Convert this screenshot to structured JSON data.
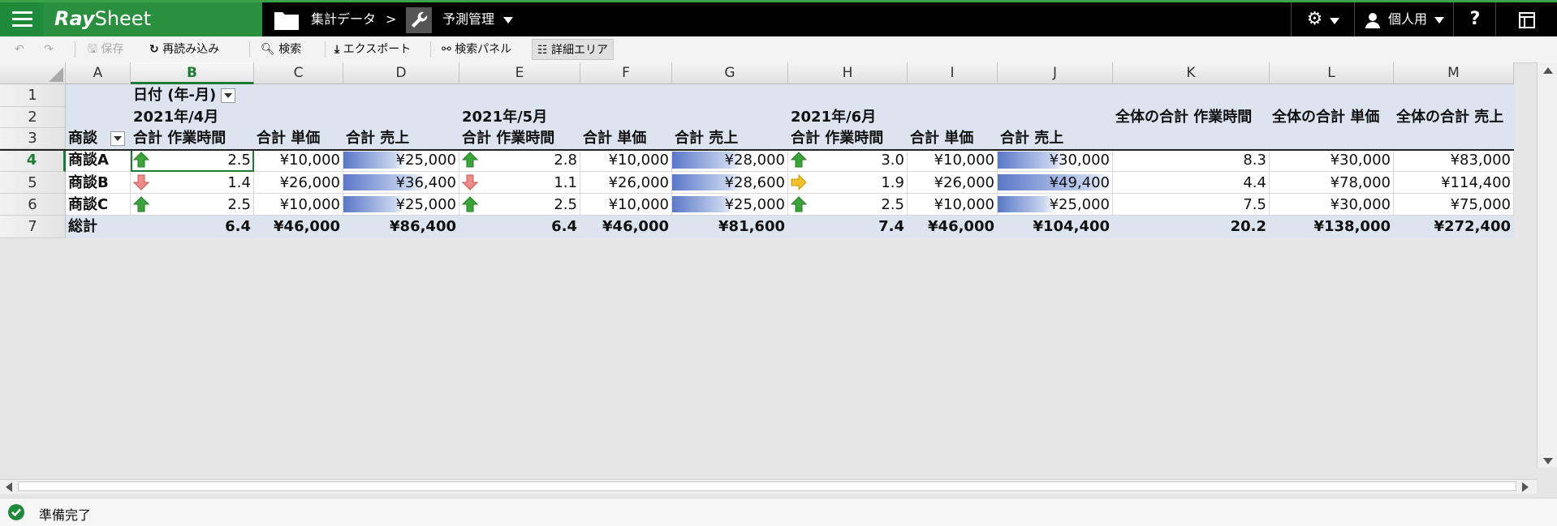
{
  "app": {
    "logo_main": "Ray",
    "logo_sub": "Sheet"
  },
  "breadcrumb": {
    "folder": "集計データ",
    "separator": ">",
    "current": "予測管理"
  },
  "topbar": {
    "user_label": "個人用",
    "help": "?"
  },
  "toolbar": {
    "save": "保存",
    "reload": "再読み込み",
    "search": "検索",
    "export": "エクスポート",
    "search_panel": "検索パネル",
    "detail_area": "詳細エリア"
  },
  "grid": {
    "columns": [
      "A",
      "B",
      "C",
      "D",
      "E",
      "F",
      "G",
      "H",
      "I",
      "J",
      "K",
      "L",
      "M"
    ],
    "selected_column": "B",
    "rows": [
      "1",
      "2",
      "3",
      "4",
      "5",
      "6",
      "7"
    ],
    "selected_row": "4",
    "date_field": "日付 (年-月)",
    "row_field": "商談",
    "months": [
      "2021年/4月",
      "2021年/5月",
      "2021年/6月"
    ],
    "measure_headers": [
      "合計 作業時間",
      "合計 単価",
      "合計 売上"
    ],
    "grand_headers": [
      "全体の合計 作業時間",
      "全体の合計 単価",
      "全体の合計 売上"
    ],
    "data_rows": [
      {
        "name": "商談A",
        "arrows": [
          "up",
          "up",
          "up"
        ],
        "bars": [
          0.55,
          0.62,
          0.6
        ],
        "values": [
          "2.5",
          "¥10,000",
          "¥25,000",
          "2.8",
          "¥10,000",
          "¥28,000",
          "3.0",
          "¥10,000",
          "¥30,000",
          "8.3",
          "¥30,000",
          "¥83,000"
        ]
      },
      {
        "name": "商談B",
        "arrows": [
          "down",
          "down",
          "right"
        ],
        "bars": [
          0.72,
          0.62,
          1.0
        ],
        "values": [
          "1.4",
          "¥26,000",
          "¥36,400",
          "1.1",
          "¥26,000",
          "¥28,600",
          "1.9",
          "¥26,000",
          "¥49,400",
          "4.4",
          "¥78,000",
          "¥114,400"
        ]
      },
      {
        "name": "商談C",
        "arrows": [
          "up",
          "up",
          "up"
        ],
        "bars": [
          0.55,
          0.55,
          0.5
        ],
        "values": [
          "2.5",
          "¥10,000",
          "¥25,000",
          "2.5",
          "¥10,000",
          "¥25,000",
          "2.5",
          "¥10,000",
          "¥25,000",
          "7.5",
          "¥30,000",
          "¥75,000"
        ]
      }
    ],
    "total_row": {
      "name": "総計",
      "values": [
        "6.4",
        "¥46,000",
        "¥86,400",
        "6.4",
        "¥46,000",
        "¥81,600",
        "7.4",
        "¥46,000",
        "¥104,400",
        "20.2",
        "¥138,000",
        "¥272,400"
      ]
    }
  },
  "status": {
    "text": "準備完了"
  },
  "colors": {
    "brand_green": "#2a8f3f",
    "header_blue": "#dce4f0",
    "bar_blue": "#5a78c8",
    "arrow_up": "#3aa33a",
    "arrow_down": "#e37b7b",
    "arrow_side": "#f2c12e"
  }
}
